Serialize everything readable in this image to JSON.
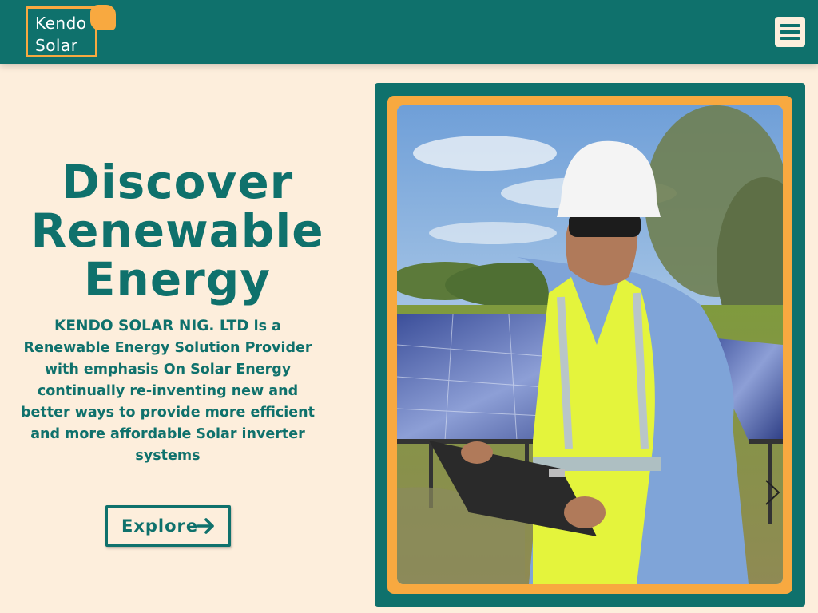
{
  "brand": {
    "line1": "Kendo",
    "line2": "Solar",
    "primary_color": "#0f716c",
    "accent_color": "#f8a940",
    "background_color": "#fdeedc"
  },
  "nav": {
    "menu_icon": "hamburger-menu-icon"
  },
  "hero": {
    "title_lines": [
      "Discover",
      "Renewable",
      "Energy"
    ],
    "company": "KENDO SOLAR NIG. LTD",
    "description": " is a Renewable Energy Solution Provider with emphasis On Solar Energy continually re-inventing new and better ways to provide more efficient and more affordable Solar inverter systems",
    "button_label": "Explore",
    "button_icon": "arrow-right-icon"
  }
}
